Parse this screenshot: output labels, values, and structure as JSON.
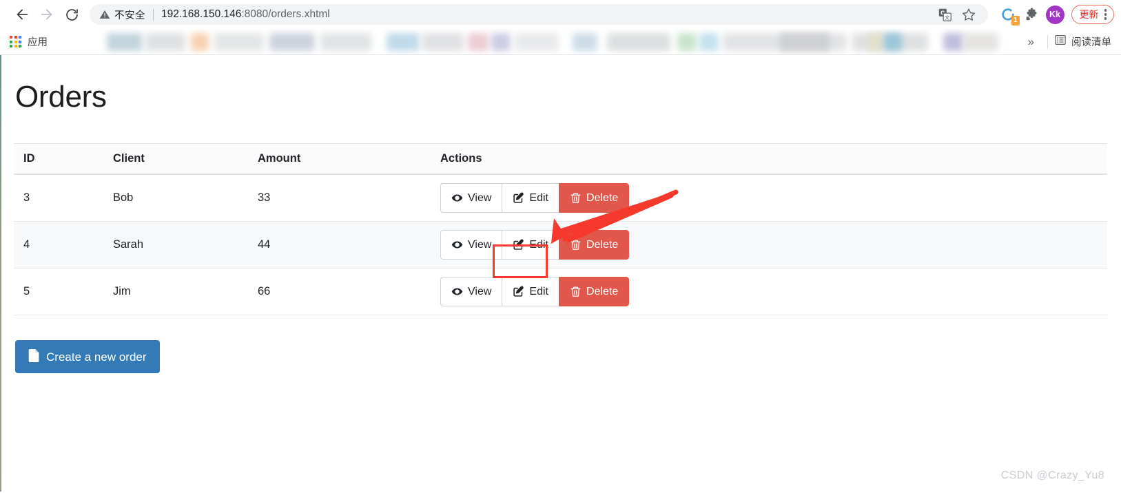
{
  "browser": {
    "nav": {
      "back_icon": "arrow-left-icon",
      "forward_icon": "arrow-right-icon",
      "reload_icon": "reload-icon"
    },
    "omnibox": {
      "security_icon": "warning-triangle-icon",
      "security_label": "不安全",
      "url_host": "192.168.150.146",
      "url_rest": ":8080/orders.xhtml",
      "translate_icon": "translate-icon",
      "bookmark_icon": "star-icon"
    },
    "actions": {
      "extension_badge_icon": "extension-sync-icon",
      "extension_badge_count": "1",
      "puzzle_icon": "puzzle-piece-icon",
      "avatar_initials": "Kk",
      "update_label": "更新",
      "menu_icon": "kebab-menu-icon"
    },
    "bookmarks_bar": {
      "apps_icon": "apps-grid-icon",
      "apps_label": "应用",
      "overflow_icon": "chevron-double-right-icon",
      "reading_list_icon": "reading-list-icon",
      "reading_list_label": "阅读清单"
    }
  },
  "page": {
    "title": "Orders",
    "table": {
      "columns": [
        "ID",
        "Client",
        "Amount",
        "Actions"
      ],
      "rows": [
        {
          "id": "3",
          "client": "Bob",
          "amount": "33"
        },
        {
          "id": "4",
          "client": "Sarah",
          "amount": "44"
        },
        {
          "id": "5",
          "client": "Jim",
          "amount": "66"
        }
      ],
      "actions": {
        "view_label": "View",
        "view_icon": "eye-icon",
        "edit_label": "Edit",
        "edit_icon": "pencil-square-icon",
        "delete_label": "Delete",
        "delete_icon": "trash-icon"
      }
    },
    "create_button": {
      "label": "Create a new order",
      "icon": "file-document-icon"
    },
    "watermark": "CSDN @Crazy_Yu8"
  },
  "annotations": {
    "highlight_target": "edit-button-row-1",
    "arrow_color": "#f5392c",
    "highlight_color": "#f5392c"
  },
  "colors": {
    "primary_button": "#337ab7",
    "danger_button": "#e2574c",
    "annotation_red": "#f5392c",
    "avatar": "#a335c4",
    "update_text": "#d93025"
  }
}
